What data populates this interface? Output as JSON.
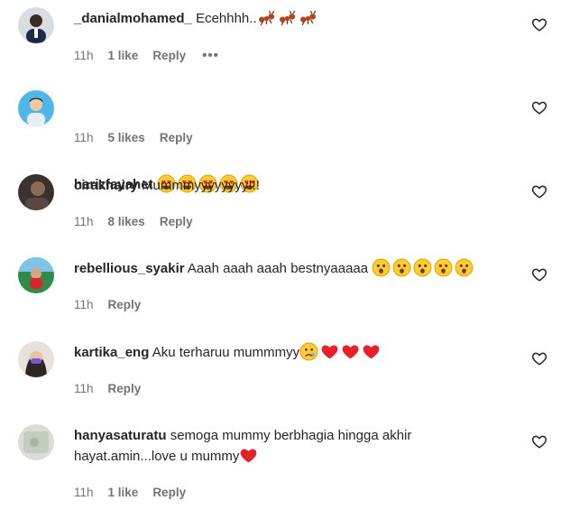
{
  "comments": [
    {
      "user": "_danialmohamed_",
      "text": "Ecehhhh..",
      "emojis": [
        "ant-emoji",
        "ant-emoji",
        "ant-emoji"
      ],
      "time": "11h",
      "likes": "1 like",
      "reply": "Reply",
      "more": "•••"
    },
    {
      "user": "harizfayahet",
      "text": "",
      "emojis": [
        "heart-eyes-emoji",
        "heart-eyes-emoji",
        "heart-eyes-emoji",
        "heart-eyes-emoji",
        "heart-eyes-emoji"
      ],
      "time": "11h",
      "likes": "5 likes",
      "reply": "Reply"
    },
    {
      "user": "cirakhairy",
      "text": "Mummmyyyyyyyy!!!",
      "emojis": [],
      "time": "11h",
      "likes": "8 likes",
      "reply": "Reply"
    },
    {
      "user": "rebellious_syakir",
      "text": "Aaah aaah aaah bestnyaaaaa",
      "emojis": [
        "astonished-emoji",
        "astonished-emoji",
        "astonished-emoji",
        "astonished-emoji",
        "astonished-emoji"
      ],
      "time": "11h",
      "likes": "",
      "reply": "Reply"
    },
    {
      "user": "kartika_eng",
      "text": "Aku terharuu mummmyy",
      "emojis": [
        "sad-tear-emoji",
        "red-heart-emoji",
        "red-heart-emoji",
        "red-heart-emoji"
      ],
      "time": "11h",
      "likes": "",
      "reply": "Reply"
    },
    {
      "user": "hanyasaturatu",
      "text": "semoga mummy berbhagia hingga akhir hayat.amin...love u mummy",
      "emojis": [
        "red-heart-emoji"
      ],
      "time": "11h",
      "likes": "1 like",
      "reply": "Reply"
    }
  ],
  "colors": {
    "text": "#262626",
    "muted": "#737373",
    "heart_outline": "#262626"
  }
}
